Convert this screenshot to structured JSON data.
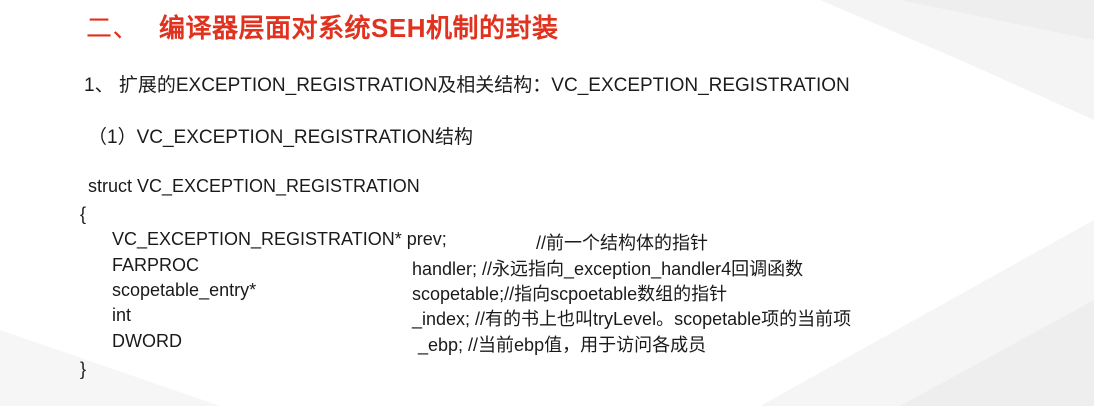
{
  "title": {
    "number": "二、",
    "text": "编译器层面对系统SEH机制的封装"
  },
  "subheading1": "1、 扩展的EXCEPTION_REGISTRATION及相关结构：VC_EXCEPTION_REGISTRATION",
  "subheading2": "（1）VC_EXCEPTION_REGISTRATION结构",
  "code": {
    "struct_decl": "struct VC_EXCEPTION_REGISTRATION",
    "open_brace": "{",
    "close_brace": "}",
    "fields": [
      {
        "type": "VC_EXCEPTION_REGISTRATION* prev;",
        "rest": "//前一个结构体的指针"
      },
      {
        "type": "FARPROC",
        "rest": "handler; //永远指向_exception_handler4回调函数"
      },
      {
        "type": "scopetable_entry*",
        "rest": "scopetable;//指向scpoetable数组的指针"
      },
      {
        "type": "int",
        "rest": "_index; //有的书上也叫tryLevel。scopetable项的当前项"
      },
      {
        "type": "DWORD",
        "rest": "_ebp;  //当前ebp值，用于访问各成员"
      }
    ]
  },
  "colors": {
    "title": "#e0321e",
    "text": "#1a1a1a",
    "background": "#ffffff"
  }
}
